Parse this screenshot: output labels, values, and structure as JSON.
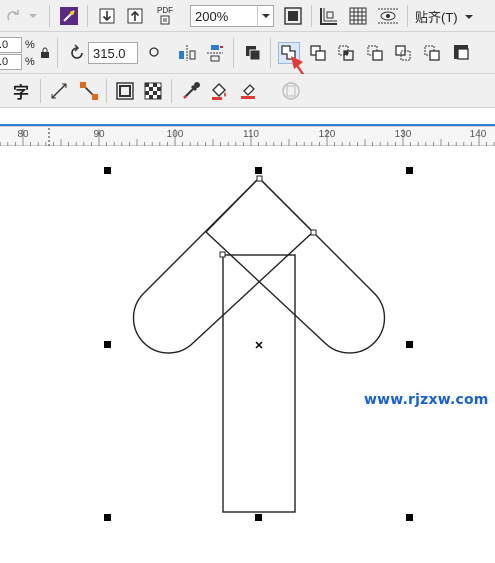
{
  "toolbar_top": {
    "pdf_label": "PDF",
    "zoom": "200%",
    "snap_label": "贴齐(T)"
  },
  "toolbar_props": {
    "size_top": ".0",
    "size_bottom": ".0",
    "percent": "%",
    "rotation": "315.0"
  },
  "toolbar_tools": {
    "text_tool": "字"
  },
  "ruler": {
    "ticks": [
      "80",
      "90",
      "100",
      "110",
      "120",
      "130",
      "140"
    ]
  },
  "watermark": "www.rjzxw.com",
  "colors": {
    "toolbar_bg": "#f0f0f0",
    "accent_blue": "#2c7fd8",
    "annotation_arrow": "#e53935",
    "watermark": "#1b5fd6"
  }
}
